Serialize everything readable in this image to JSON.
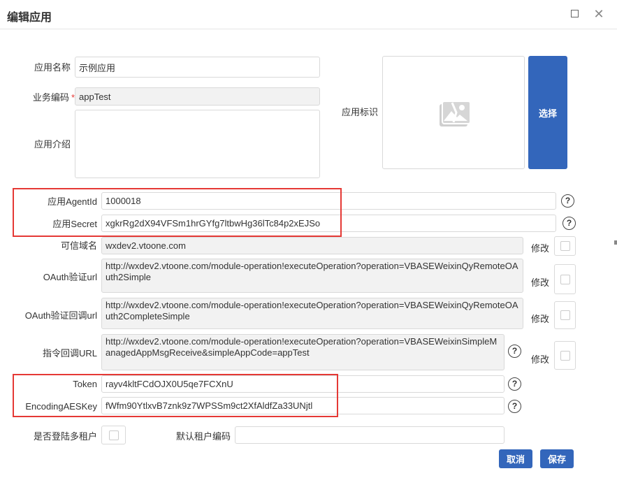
{
  "dialog": {
    "title": "编辑应用"
  },
  "form": {
    "app_name": {
      "label": "应用名称",
      "value": "示例应用"
    },
    "biz_code": {
      "label": "业务编码",
      "required_mark": "*",
      "value": "appTest"
    },
    "app_intro": {
      "label": "应用介绍",
      "value": ""
    },
    "app_logo": {
      "label": "应用标识",
      "select_label": "选择",
      "icon": "image-placeholder-icon"
    },
    "agent_id": {
      "label": "应用AgentId",
      "value": "1000018"
    },
    "secret": {
      "label": "应用Secret",
      "value": "xgkrRg2dX94VFSm1hrGYfg7ltbwHg36lTc84p2xEJSo"
    },
    "trusted_domain": {
      "label": "可信域名",
      "value": "wxdev2.vtoone.com",
      "modify_label": "修改"
    },
    "oauth_url": {
      "label": "OAuth验证url",
      "value": "http://wxdev2.vtoone.com/module-operation!executeOperation?operation=VBASEWeixinQyRemoteOAuth2Simple",
      "modify_label": "修改"
    },
    "oauth_callback": {
      "label": "OAuth验证回调url",
      "value": "http://wxdev2.vtoone.com/module-operation!executeOperation?operation=VBASEWeixinQyRemoteOAuth2CompleteSimple",
      "modify_label": "修改"
    },
    "cmd_callback": {
      "label": "指令回调URL",
      "value": "http://wxdev2.vtoone.com/module-operation!executeOperation?operation=VBASEWeixinSimpleManagedAppMsgReceive&simpleAppCode=appTest",
      "modify_label": "修改"
    },
    "token": {
      "label": "Token",
      "value": "rayv4kltFCdOJX0U5qe7FCXnU"
    },
    "aes_key": {
      "label": "EncodingAESKey",
      "value": "fWfm90YtlxvB7znk9z7WPSSm9ct2XfAldfZa33UNjtl"
    },
    "multi_tenant": {
      "label": "是否登陆多租户"
    },
    "default_tenant": {
      "label": "默认租户编码",
      "value": ""
    },
    "help_glyph": "?"
  },
  "buttons": {
    "cancel": "取消",
    "save": "保存"
  },
  "colors": {
    "primary": "#3366bb",
    "highlight_box": "#e53935"
  }
}
